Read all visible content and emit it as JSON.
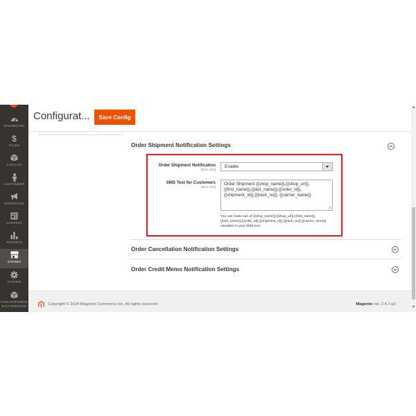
{
  "sidebar": {
    "items": [
      {
        "label": "DASHBOARD",
        "icon": "dashboard-icon"
      },
      {
        "label": "SALES",
        "icon": "dollar-icon"
      },
      {
        "label": "CATALOG",
        "icon": "box-icon"
      },
      {
        "label": "CUSTOMERS",
        "icon": "person-icon"
      },
      {
        "label": "MARKETING",
        "icon": "megaphone-icon"
      },
      {
        "label": "CONTENT",
        "icon": "content-icon"
      },
      {
        "label": "REPORTS",
        "icon": "bar-chart-icon"
      },
      {
        "label": "STORES",
        "icon": "store-icon"
      },
      {
        "label": "SYSTEM",
        "icon": "gear-icon"
      },
      {
        "label": "FIND PARTNERS & EXTENSIONS",
        "icon": "extensions-icon"
      }
    ],
    "active": "STORES"
  },
  "header": {
    "title": "Configurat...",
    "save_label": "Save Config"
  },
  "sections": {
    "shipment": {
      "title": "Order Shipment Notification Settings",
      "notification_label": "Order Shipment Notification",
      "notification_scope": "[store view]",
      "notification_value": "Enable",
      "sms_label": "SMS Text for Customers",
      "sms_scope": "[store view]",
      "sms_text": "Order Shipment {{shop_name}},{{shop_url}},{{first_name}},{{last_name}},{{order_id}},{{shipment_id}},{{track_no}}, {{carrier_name}}",
      "sms_note": "You can make use of {{shop_name}},{{shop_url}},{{first_name}},{{last_name}},{{order_id}},{{shipment_id}},{{track_no}},{{carrier_name}} variables in your SMS text."
    },
    "cancellation": {
      "title": "Order Cancellation Notification Settings"
    },
    "creditmemo": {
      "title": "Order Credit Memo Notification Settings"
    }
  },
  "footer": {
    "copyright": "Copyright © 2024 Magento Commerce Inc. All rights reserved.",
    "brand": "Magento",
    "version": " ver. 2.4.7-p2"
  },
  "colors": {
    "accent": "#eb5202",
    "sidebar_bg": "#373330",
    "highlight": "#d9262d"
  }
}
